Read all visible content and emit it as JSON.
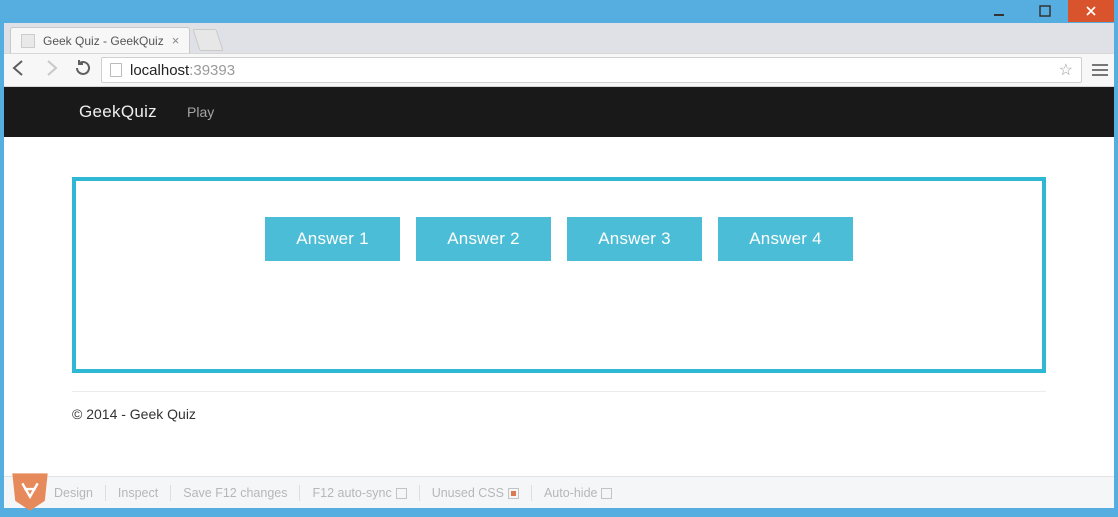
{
  "window": {
    "tab_title": "Geek Quiz - GeekQuiz",
    "url_host": "localhost",
    "url_port": ":39393"
  },
  "navbar": {
    "brand": "GeekQuiz",
    "links": [
      "Play"
    ]
  },
  "quiz": {
    "answers": [
      "Answer 1",
      "Answer 2",
      "Answer 3",
      "Answer 4"
    ]
  },
  "footer": {
    "copyright": "© 2014 - Geek Quiz"
  },
  "browserlink": {
    "design": "Design",
    "inspect": "Inspect",
    "save": "Save F12 changes",
    "autosync": "F12 auto-sync",
    "unused": "Unused CSS",
    "autohide": "Auto-hide",
    "autosync_checked": false,
    "unused_checked": true,
    "autohide_checked": false
  }
}
